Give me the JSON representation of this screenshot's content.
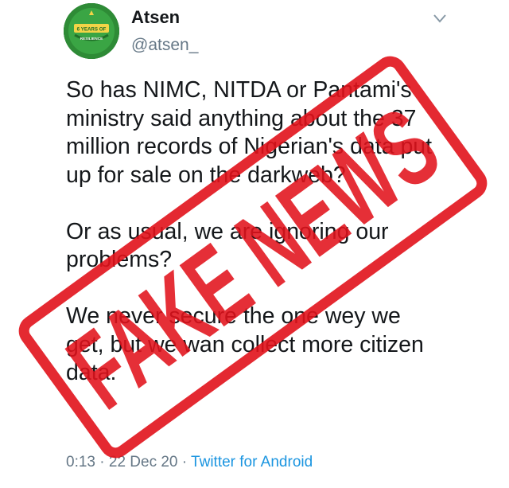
{
  "tweet": {
    "display_name": "Atsen",
    "handle": "@atsen_",
    "avatar": {
      "icon": "profile-badge-icon",
      "badge_text": "6 YEARS OF",
      "badge_subtext": "RESILIENCE"
    },
    "menu_icon": "chevron-down-icon",
    "paragraphs": [
      "So has NIMC, NITDA or Pantami's ministry said anything about the 37 million records of Nigerian's data put up for sale on the darkweb?",
      "Or as usual, we are ignoring our problems?",
      "We never secure the one wey we get, but we wan collect more citizen data."
    ],
    "time": "0:13",
    "date": "22 Dec 20",
    "separator": "·",
    "source": "Twitter for Android"
  },
  "overlay": {
    "stamp_text": "FAKE NEWS",
    "stamp_color": "#e1121b"
  }
}
